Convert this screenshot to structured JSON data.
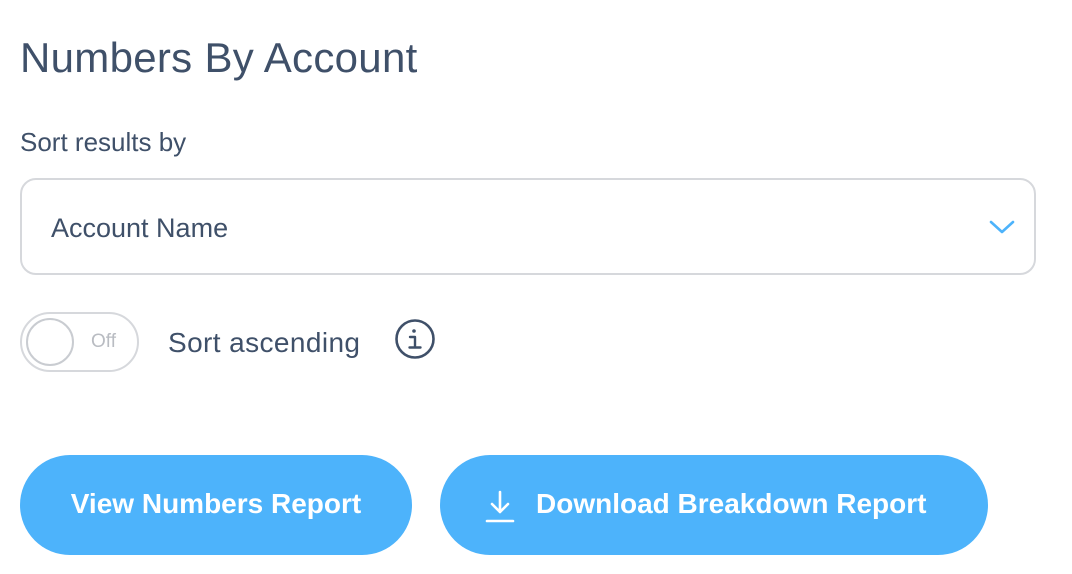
{
  "page": {
    "title": "Numbers By Account"
  },
  "sort": {
    "label": "Sort results by",
    "selected": "Account Name",
    "chevron_icon": "chevron-down-icon"
  },
  "ascending_toggle": {
    "state_text": "Off",
    "label": "Sort ascending",
    "info_icon": "info-icon"
  },
  "buttons": {
    "view_label": "View Numbers Report",
    "download_label": "Download Breakdown Report",
    "download_icon": "download-icon"
  },
  "colors": {
    "accent": "#4db3fb",
    "text": "#3f5069",
    "border": "#d6d8dc",
    "muted": "#b9bcc2"
  }
}
